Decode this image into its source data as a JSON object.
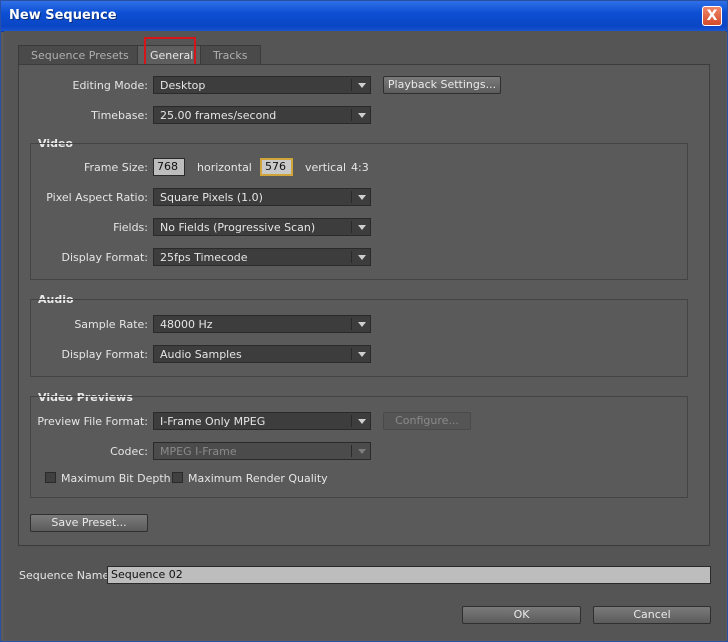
{
  "window": {
    "title": "New Sequence",
    "close_glyph": "X"
  },
  "tabs": [
    {
      "label": "Sequence Presets",
      "active": false
    },
    {
      "label": "General",
      "active": true
    },
    {
      "label": "Tracks",
      "active": false
    }
  ],
  "general": {
    "editing_mode": {
      "label": "Editing Mode:",
      "value": "Desktop"
    },
    "playback_settings_label": "Playback Settings...",
    "timebase": {
      "label": "Timebase:",
      "value": "25.00 frames/second"
    }
  },
  "video": {
    "section": "Video",
    "frame_size": {
      "label": "Frame Size:",
      "horizontal": "768",
      "horizontal_label": "horizontal",
      "vertical": "576",
      "vertical_label": "vertical",
      "aspect": "4:3"
    },
    "pixel_aspect_ratio": {
      "label": "Pixel Aspect Ratio:",
      "value": "Square Pixels (1.0)"
    },
    "fields": {
      "label": "Fields:",
      "value": "No Fields (Progressive Scan)"
    },
    "display_format": {
      "label": "Display Format:",
      "value": "25fps Timecode"
    }
  },
  "audio": {
    "section": "Audio",
    "sample_rate": {
      "label": "Sample Rate:",
      "value": "48000 Hz"
    },
    "display_format": {
      "label": "Display Format:",
      "value": "Audio Samples"
    }
  },
  "video_previews": {
    "section": "Video Previews",
    "preview_file_format": {
      "label": "Preview File Format:",
      "value": "I-Frame Only MPEG"
    },
    "configure_label": "Configure...",
    "codec": {
      "label": "Codec:",
      "value": "MPEG I-Frame"
    },
    "max_bit_depth_label": "Maximum Bit Depth",
    "max_render_quality_label": "Maximum Render Quality"
  },
  "save_preset_label": "Save Preset...",
  "sequence_name": {
    "label": "Sequence Name:",
    "value": "Sequence 02"
  },
  "ok_label": "OK",
  "cancel_label": "Cancel"
}
